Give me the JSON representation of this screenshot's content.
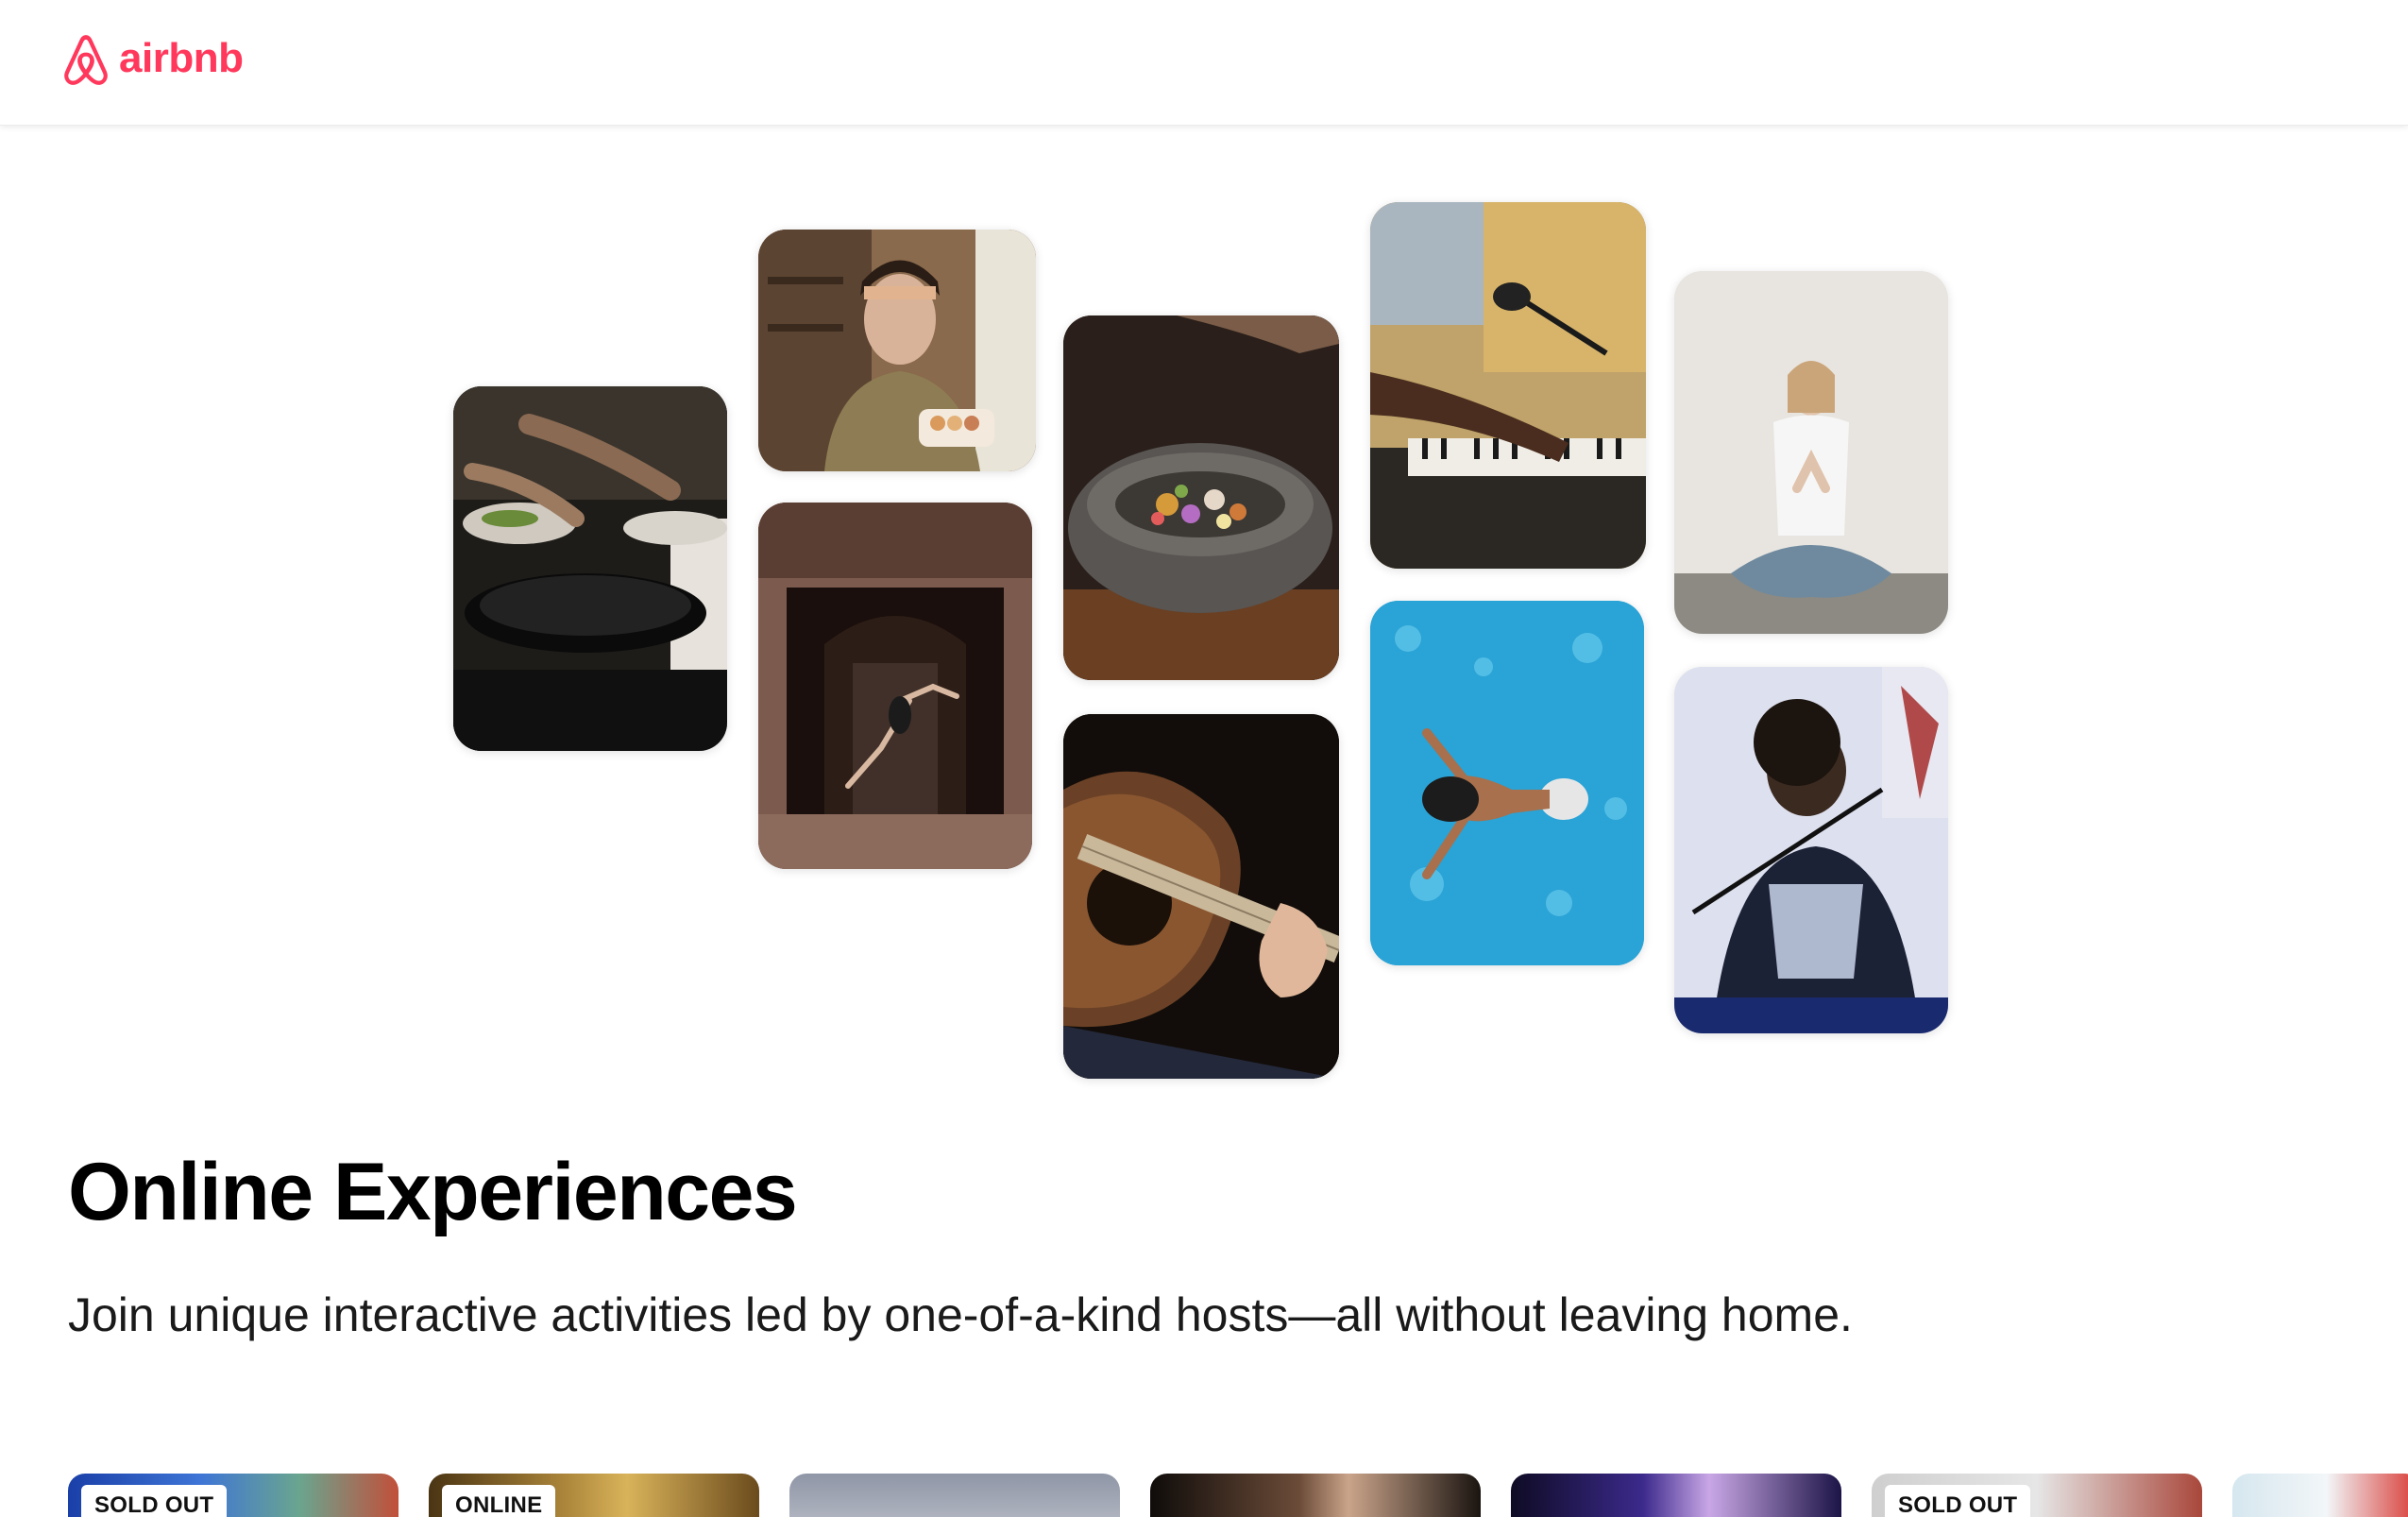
{
  "brand": {
    "name": "airbnb",
    "color": "#FF385C"
  },
  "collage": {
    "tiles": [
      {
        "name": "cooking",
        "icon": "cooking-photo"
      },
      {
        "name": "baker",
        "icon": "baker-photo"
      },
      {
        "name": "dancer",
        "icon": "dancer-photo"
      },
      {
        "name": "bowl",
        "icon": "food-bowl-photo"
      },
      {
        "name": "guitar",
        "icon": "guitar-photo"
      },
      {
        "name": "piano",
        "icon": "piano-photo"
      },
      {
        "name": "swimmer",
        "icon": "swimmer-photo"
      },
      {
        "name": "yoga",
        "icon": "yoga-photo"
      },
      {
        "name": "singer",
        "icon": "singer-photo"
      }
    ]
  },
  "hero": {
    "title": "Online Experiences",
    "subtitle": "Join unique interactive activities led by one-of-a-kind hosts—all without leaving home."
  },
  "cards": [
    {
      "badge": "SOLD OUT"
    },
    {
      "badge": "ONLINE"
    },
    {
      "badge": ""
    },
    {
      "badge": ""
    },
    {
      "badge": ""
    },
    {
      "badge": "SOLD OUT"
    },
    {
      "badge": ""
    }
  ]
}
